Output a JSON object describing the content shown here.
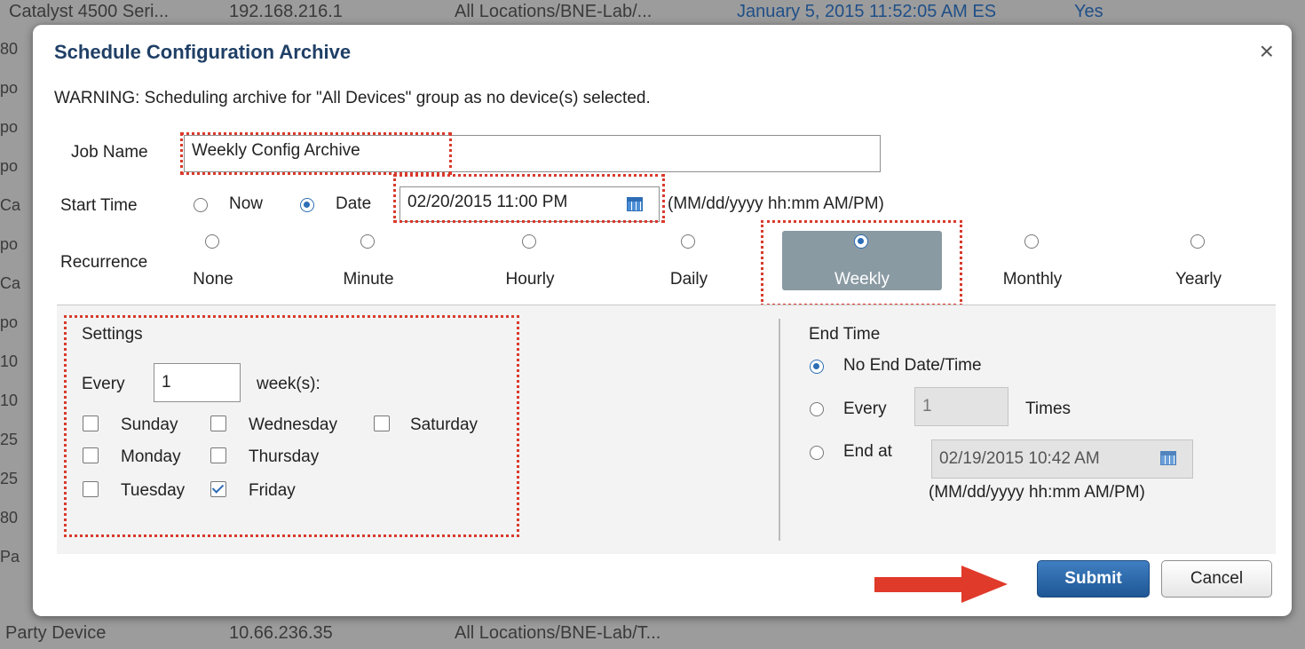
{
  "background": {
    "top_row": [
      "Catalyst 4500 Seri...",
      "192.168.216.1",
      "All Locations/BNE-Lab/...",
      "January 5, 2015 11:52:05 AM ES",
      "Yes"
    ],
    "bottom_row": [
      "Party Device",
      "10.66.236.35",
      "All Locations/BNE-Lab/T..."
    ],
    "left_fragments": [
      "80",
      "po",
      "po",
      "po",
      "Ca",
      "po",
      "Ca",
      "po",
      "10",
      "10",
      "25",
      "25",
      "80",
      "Pa"
    ]
  },
  "dialog": {
    "title": "Schedule Configuration Archive",
    "close_symbol": "×",
    "warning": "WARNING: Scheduling archive for \"All Devices\" group as no device(s) selected.",
    "job_name_label": "Job Name",
    "job_name_value": "Weekly Config Archive",
    "start_time_label": "Start Time",
    "start_now_label": "Now",
    "start_date_label": "Date",
    "start_date_value": "02/20/2015 11:00 PM",
    "start_format_hint": "(MM/dd/yyyy hh:mm AM/PM)",
    "recurrence_label": "Recurrence",
    "recurrence_options": [
      "None",
      "Minute",
      "Hourly",
      "Daily",
      "Weekly",
      "Monthly",
      "Yearly"
    ],
    "recurrence_selected": "Weekly",
    "settings": {
      "title": "Settings",
      "every_label": "Every",
      "every_value": "1",
      "unit_label": "week(s):",
      "days": {
        "sunday": "Sunday",
        "monday": "Monday",
        "tuesday": "Tuesday",
        "wednesday": "Wednesday",
        "thursday": "Thursday",
        "friday": "Friday",
        "saturday": "Saturday"
      },
      "checked_day": "Friday"
    },
    "end_time": {
      "title": "End Time",
      "no_end_label": "No End Date/Time",
      "every_label": "Every",
      "every_value": "1",
      "times_label": "Times",
      "end_at_label": "End at",
      "end_at_value": "02/19/2015 10:42 AM",
      "format_hint": "(MM/dd/yyyy hh:mm AM/PM)",
      "selected": "No End Date/Time"
    },
    "submit_label": "Submit",
    "cancel_label": "Cancel"
  },
  "colors": {
    "title": "#1f3f66",
    "highlight_dotted": "#d93a2c",
    "arrow": "#e03a2a",
    "weekly_selected_bg": "#8a9aa3",
    "primary_button": "#1e5695"
  }
}
